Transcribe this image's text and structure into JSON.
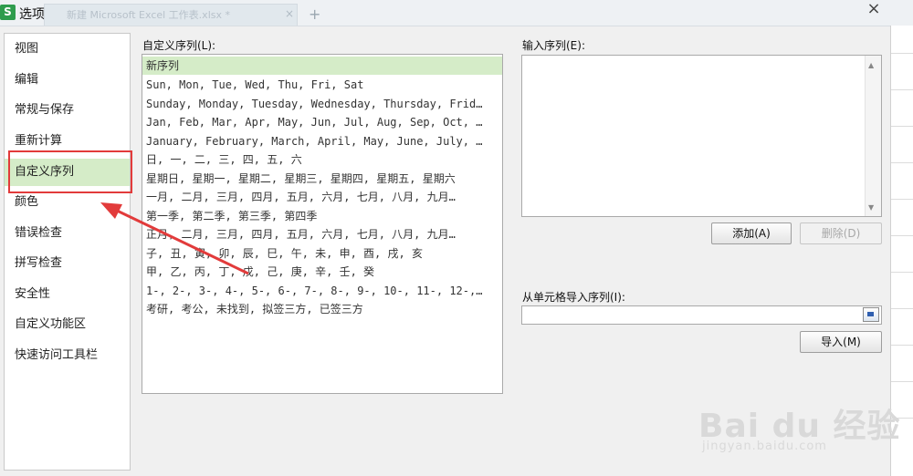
{
  "window": {
    "app_icon": "S",
    "title": "选项",
    "background_tab": "新建 Microsoft Excel 工作表.xlsx *",
    "background_tab_close": "×",
    "background_tab_add": "+",
    "close_glyph": "×"
  },
  "sidebar": {
    "items": [
      {
        "label": "视图"
      },
      {
        "label": "编辑"
      },
      {
        "label": "常规与保存"
      },
      {
        "label": "重新计算"
      },
      {
        "label": "自定义序列"
      },
      {
        "label": "颜色"
      },
      {
        "label": "错误检查"
      },
      {
        "label": "拼写检查"
      },
      {
        "label": "安全性"
      },
      {
        "label": "自定义功能区"
      },
      {
        "label": "快速访问工具栏"
      }
    ],
    "selected_index": 4
  },
  "custom_lists": {
    "label": "自定义序列(L):",
    "rows": [
      "新序列",
      "Sun, Mon, Tue, Wed, Thu, Fri, Sat",
      "Sunday, Monday, Tuesday, Wednesday, Thursday, Frid…",
      "Jan, Feb, Mar, Apr, May, Jun, Jul, Aug, Sep, Oct, …",
      "January, February, March, April, May, June, July, …",
      "日, 一, 二, 三, 四, 五, 六",
      "星期日, 星期一, 星期二, 星期三, 星期四, 星期五, 星期六",
      "一月, 二月, 三月, 四月, 五月, 六月, 七月, 八月, 九月…",
      "第一季, 第二季, 第三季, 第四季",
      "正月, 二月, 三月, 四月, 五月, 六月, 七月, 八月, 九月…",
      "子, 丑, 寅, 卯, 辰, 巳, 午, 未, 申, 酉, 戌, 亥",
      "甲, 乙, 丙, 丁, 戊, 己, 庚, 辛, 壬, 癸",
      "1-, 2-, 3-, 4-, 5-, 6-, 7-, 8-, 9-, 10-, 11-, 12-,…",
      "考研, 考公, 未找到, 拟签三方, 已签三方"
    ]
  },
  "entries": {
    "label": "输入序列(E):",
    "value": "",
    "add_button": "添加(A)",
    "delete_button": "删除(D)"
  },
  "import": {
    "label": "从单元格导入序列(I):",
    "value": "",
    "button": "导入(M)"
  },
  "watermark": {
    "big": "Bai du 经验",
    "small": "jingyan.baidu.com"
  },
  "colors": {
    "selected_bg": "#d5ecc8",
    "annotation_red": "#e23b3b",
    "app_icon_green": "#2e9c4d"
  }
}
